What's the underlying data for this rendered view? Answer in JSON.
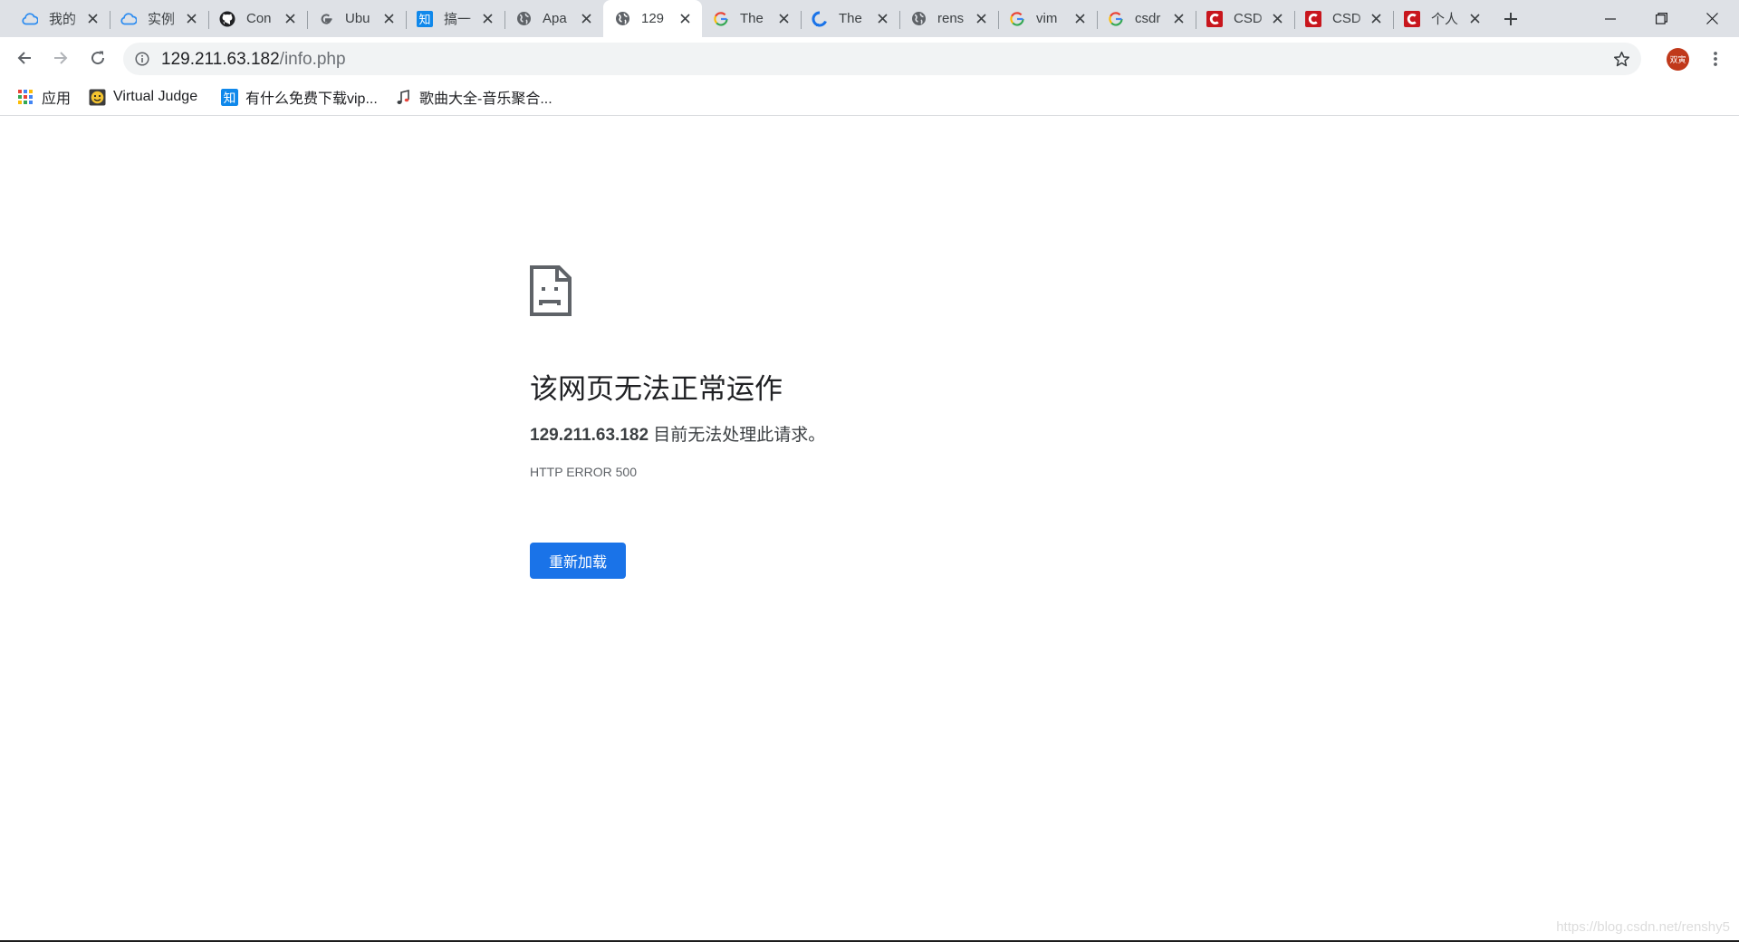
{
  "browser": {
    "tabs": [
      {
        "title": "我的",
        "icon": "cloud-icon",
        "active": false
      },
      {
        "title": "实例",
        "icon": "cloud-icon",
        "active": false
      },
      {
        "title": "Con",
        "icon": "github-icon",
        "active": false
      },
      {
        "title": "Ubu",
        "icon": "google-icon",
        "active": false
      },
      {
        "title": "搞一",
        "icon": "zhihu-icon",
        "active": false
      },
      {
        "title": "Apa",
        "icon": "globe-icon",
        "active": false
      },
      {
        "title": "129",
        "icon": "globe-icon",
        "active": true
      },
      {
        "title": "The",
        "icon": "google-icon",
        "active": false
      },
      {
        "title": "The",
        "icon": "blue-loop-icon",
        "active": false
      },
      {
        "title": "rens",
        "icon": "globe-icon",
        "active": false
      },
      {
        "title": "vim",
        "icon": "google-icon",
        "active": false
      },
      {
        "title": "csdr",
        "icon": "google-icon",
        "active": false
      },
      {
        "title": "CSD",
        "icon": "csdn-icon",
        "active": false
      },
      {
        "title": "CSD",
        "icon": "csdn-icon",
        "active": false
      },
      {
        "title": "个人",
        "icon": "csdn-icon",
        "active": false
      }
    ],
    "address": {
      "host": "129.211.63.182",
      "path": "/info.php"
    },
    "profile_label": "双寅",
    "bookmarks": [
      {
        "label": "应用",
        "icon": "apps-grid-icon"
      },
      {
        "label": "Virtual Judge",
        "icon": "vjudge-icon"
      },
      {
        "label": "有什么免费下载vip...",
        "icon": "zhihu-icon"
      },
      {
        "label": "歌曲大全-音乐聚合...",
        "icon": "music-note-icon"
      }
    ]
  },
  "error_page": {
    "title": "该网页无法正常运作",
    "host": "129.211.63.182",
    "message": " 目前无法处理此请求。",
    "code": "HTTP ERROR 500",
    "reload_label": "重新加载"
  },
  "watermark": "https://blog.csdn.net/renshy5",
  "colors": {
    "tabstrip": "#dee1e6",
    "accent": "#1a73e8",
    "csdn_red": "#c8161d",
    "zhihu_blue": "#0f88eb"
  }
}
